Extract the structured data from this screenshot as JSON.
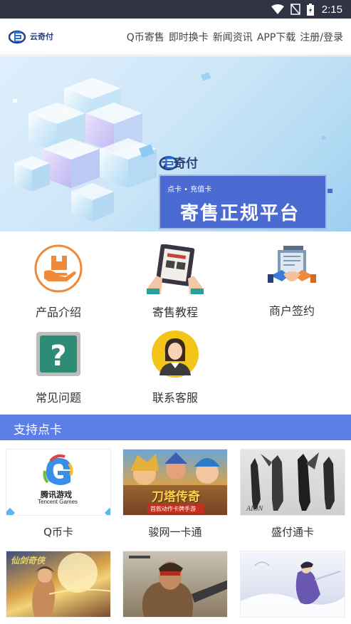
{
  "status_bar": {
    "time": "2:15"
  },
  "header": {
    "logo_text": "云奇付",
    "nav": [
      "Q币寄售",
      "即时换卡",
      "新闻资讯",
      "APP下载",
      "注册/登录"
    ]
  },
  "banner": {
    "logo_text": "云奇付",
    "subtitle": "点卡 • 充值卡",
    "title": "寄售正规平台"
  },
  "features": [
    {
      "label": "产品介绍",
      "icon": "product-icon"
    },
    {
      "label": "寄售教程",
      "icon": "tutorial-icon"
    },
    {
      "label": "商户签约",
      "icon": "contract-icon"
    },
    {
      "label": "常见问题",
      "icon": "question-icon"
    },
    {
      "label": "联系客服",
      "icon": "customer-service-icon"
    }
  ],
  "section": {
    "title": "支持点卡"
  },
  "cards": [
    {
      "label": "Q币卡",
      "art_text": "腾讯游戏",
      "art_sub": "Tencent Games"
    },
    {
      "label": "骏网一卡通",
      "art_text": "刀塔传奇",
      "art_sub": "首款动作卡牌手游"
    },
    {
      "label": "盛付通卡",
      "art_text": "AION",
      "art_sub": ""
    },
    {
      "label": "",
      "art_text": "仙剑奇侠",
      "art_sub": ""
    },
    {
      "label": "",
      "art_text": "",
      "art_sub": ""
    },
    {
      "label": "",
      "art_text": "",
      "art_sub": ""
    }
  ],
  "colors": {
    "accent": "#5c7ee6",
    "status_bar": "#2f3344",
    "orange": "#ee8a3a"
  }
}
